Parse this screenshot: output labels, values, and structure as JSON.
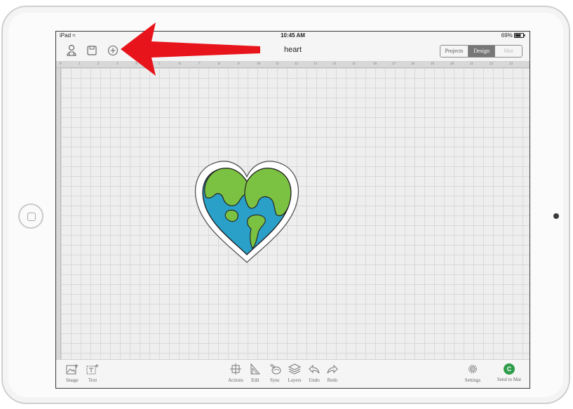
{
  "status_bar": {
    "device": "iPad",
    "time": "10:45 AM",
    "battery": "69%"
  },
  "nav": {
    "title": "heart",
    "tabs": [
      {
        "label": "Projects",
        "state": "normal"
      },
      {
        "label": "Design",
        "state": "active"
      },
      {
        "label": "Mat",
        "state": "disabled"
      }
    ],
    "icons": [
      "account-icon",
      "save-icon",
      "new-project-icon"
    ]
  },
  "ruler": {
    "ticks": [
      "0",
      "1",
      "2",
      "3",
      "4",
      "5",
      "6",
      "7",
      "8",
      "9",
      "10",
      "11",
      "12",
      "13",
      "14",
      "15",
      "16",
      "17",
      "18",
      "19",
      "20",
      "21",
      "22",
      "23"
    ]
  },
  "bottom_bar": {
    "left": [
      {
        "icon": "image-icon",
        "label": "Image"
      },
      {
        "icon": "text-icon",
        "label": "Text"
      }
    ],
    "center": [
      {
        "icon": "actions-icon",
        "label": "Actions"
      },
      {
        "icon": "edit-icon",
        "label": "Edit"
      },
      {
        "icon": "sync-icon",
        "label": "Sync"
      },
      {
        "icon": "layers-icon",
        "label": "Layers"
      },
      {
        "icon": "undo-icon",
        "label": "Undo"
      },
      {
        "icon": "redo-icon",
        "label": "Redo"
      }
    ],
    "right": [
      {
        "icon": "gear-icon",
        "label": "Settings"
      },
      {
        "icon": "send-to-mat-icon",
        "label": "Send to Mat",
        "badge": "C"
      }
    ]
  },
  "colors": {
    "arrow": "#e8141c",
    "land": "#7cc242",
    "ocean": "#2aa0c8",
    "active_tab": "#777777",
    "send_badge": "#2f9e4a"
  }
}
